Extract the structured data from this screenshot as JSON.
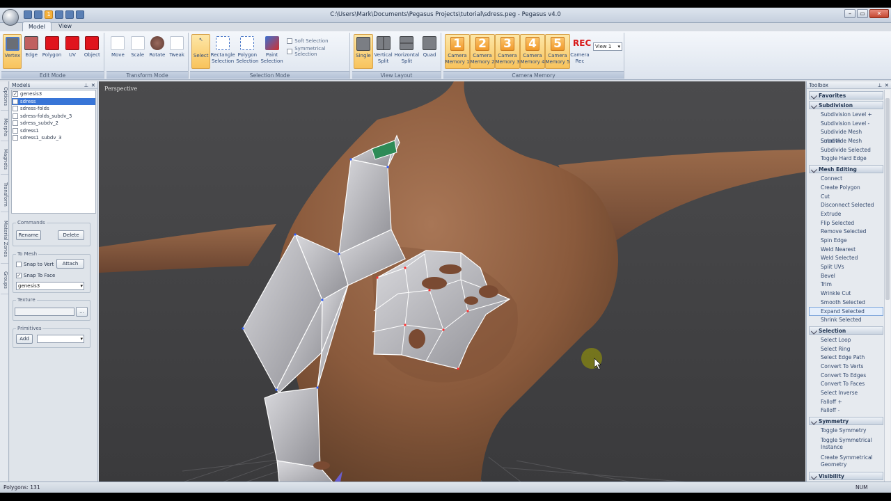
{
  "window": {
    "title": "C:\\Users\\Mark\\Documents\\Pegasus Projects\\tutorial\\sdress.peg - Pegasus v4.0",
    "qat_badge": "1"
  },
  "tabs": [
    {
      "label": "Model"
    },
    {
      "label": "View"
    }
  ],
  "ribbon": {
    "edit_mode": {
      "title": "Edit Mode",
      "buttons": [
        "Vertex",
        "Edge",
        "Polygon",
        "UV",
        "Object"
      ]
    },
    "transform_mode": {
      "title": "Transform Mode",
      "buttons": [
        "Move",
        "Scale",
        "Rotate",
        "Tweak"
      ]
    },
    "selection_mode": {
      "title": "Selection Mode",
      "buttons": [
        "Select",
        "Rectangle\nSelection",
        "Polygon\nSelection",
        "Paint\nSelection"
      ],
      "soft_selection": "Soft Selection",
      "symmetrical_selection": "Symmetrical Selection"
    },
    "view_layout": {
      "title": "View Layout",
      "buttons": [
        "Single",
        "Vertical\nSplit",
        "Horizontal\nSplit",
        "Quad"
      ]
    },
    "camera_memory": {
      "title": "Camera Memory",
      "buttons": [
        {
          "num": "1",
          "label": "Camera\nMemory 1"
        },
        {
          "num": "2",
          "label": "Camera\nMemory 2"
        },
        {
          "num": "3",
          "label": "Camera\nMemory 3"
        },
        {
          "num": "4",
          "label": "Camera\nMemory 4"
        },
        {
          "num": "5",
          "label": "Camera\nMemory 5"
        }
      ],
      "rec_icon": "REC",
      "rec_label": "Camera\nRec",
      "view_select": "View 1"
    }
  },
  "side_tabs": [
    "Options",
    "Morphs",
    "Magnets",
    "Transform",
    "Material Zones",
    "Groups"
  ],
  "models": {
    "title": "Models",
    "items": [
      {
        "name": "genesis3",
        "checked": true
      },
      {
        "name": "sdress",
        "checked": true
      },
      {
        "name": "sdress-folds",
        "checked": false
      },
      {
        "name": "sdress-folds_subdv_3",
        "checked": false
      },
      {
        "name": "sdress_subdv_2",
        "checked": false
      },
      {
        "name": "sdress1",
        "checked": false
      },
      {
        "name": "sdress1_subdv_3",
        "checked": false
      }
    ],
    "commands": {
      "title": "Commands",
      "rename": "Rename",
      "delete": "Delete"
    },
    "to_mesh": {
      "title": "To Mesh",
      "snap_to_vert": "Snap to Vert",
      "attach": "Attach",
      "snap_to_face": "Snap To Face",
      "target": "genesis3"
    },
    "texture": {
      "title": "Texture",
      "browse": "..."
    },
    "primitives": {
      "title": "Primitives",
      "add": "Add"
    }
  },
  "viewport": {
    "label": "Perspective"
  },
  "toolbox": {
    "title": "Toolbox",
    "sections": [
      {
        "name": "Favorites",
        "items": []
      },
      {
        "name": "Subdivision",
        "items": [
          "Subdivision Level +",
          "Subdivision Level -",
          "Subdivide Mesh Smooth",
          "Subdivide Mesh",
          "Subdivide Selected",
          "Toggle Hard Edge"
        ]
      },
      {
        "name": "Mesh Editing",
        "items": [
          "Connect",
          "Create Polygon",
          "Cut",
          "Disconnect Selected",
          "Extrude",
          "Flip Selected",
          "Remove Selected",
          "Spin Edge",
          "Weld Nearest",
          "Weld Selected",
          "Split UVs",
          "Bevel",
          "Trim",
          "Wrinkle Cut",
          "Smooth Selected",
          "Expand Selected",
          "Shrink Selected"
        ]
      },
      {
        "name": "Selection",
        "items": [
          "Select Loop",
          "Select Ring",
          "Select Edge Path",
          "Convert To Verts",
          "Convert To Edges",
          "Convert To Faces",
          "Select Inverse",
          "Falloff +",
          "Falloff -"
        ]
      },
      {
        "name": "Symmetry",
        "items": [
          "Toggle Symmetry",
          "Toggle Symmetrical Instance",
          "Create Symmetrical Geometry"
        ]
      },
      {
        "name": "Visibility",
        "items": []
      }
    ],
    "highlighted": "Expand Selected"
  },
  "status": {
    "polygons": "Polygons: 131",
    "num": "NUM"
  },
  "colors": {
    "accent": "#f8c35c",
    "selection": "#3875d7",
    "skin": "#8a5a3c",
    "mesh": "#bdbdc2"
  }
}
